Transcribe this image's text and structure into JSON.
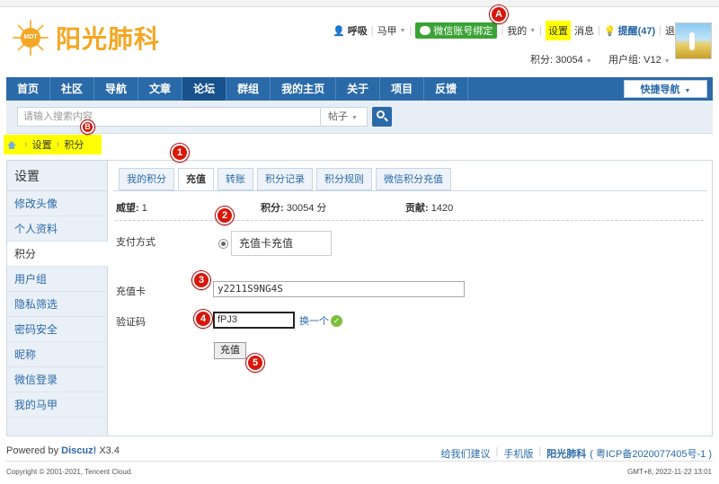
{
  "header": {
    "logo_badge": "MDT",
    "logo_text": "阳光肺科",
    "user": "呼吸",
    "alt_account": "马甲",
    "wechat_bind": "微信账号绑定",
    "mine": "我的",
    "settings": "设置",
    "messages": "消息",
    "reminders": "提醒(47)",
    "logout": "退出",
    "points": "积分: 30054",
    "user_group": "用户组: V12"
  },
  "nav": {
    "items": [
      "首页",
      "社区",
      "导航",
      "文章",
      "论坛",
      "群组",
      "我的主页",
      "关于",
      "项目",
      "反馈"
    ],
    "active": "论坛",
    "quick_nav": "快捷导航"
  },
  "search": {
    "placeholder": "请输入搜索内容",
    "scope": "帖子"
  },
  "breadcrumb": [
    "设置",
    "积分"
  ],
  "markers": [
    "A",
    "B",
    "1",
    "2",
    "3",
    "4",
    "5"
  ],
  "sidebar": {
    "title": "设置",
    "items": [
      "修改头像",
      "个人资料",
      "积分",
      "用户组",
      "隐私筛选",
      "密码安全",
      "昵称",
      "微信登录",
      "我的马甲"
    ],
    "active": "积分"
  },
  "tabs": [
    "我的积分",
    "充值",
    "转账",
    "积分记录",
    "积分规则",
    "微信积分充值"
  ],
  "stats": {
    "prestige_label": "威望:",
    "prestige": "1",
    "points_label": "积分:",
    "points": "30054 分",
    "contrib_label": "贡献:",
    "contrib": "1420"
  },
  "form": {
    "pay_label": "支付方式",
    "pay_option": "充值卡充值",
    "card_label": "充值卡",
    "card_value": "y2211S9NG4S",
    "captcha_label": "验证码",
    "captcha_value": "fPJ3",
    "change_label": "换一个",
    "submit": "充值"
  },
  "footer": {
    "powered": "Powered by ",
    "discuz": "Discuz!",
    "version": " X3.4",
    "links": [
      "给我们建议",
      "手机版",
      "阳光肺科",
      "( 粤ICP备2020077405号-1 )"
    ],
    "copyright": "Copyright © 2001-2021, Tencent Cloud.",
    "time": "GMT+8, 2022-11-22 13:01"
  },
  "colors": {
    "accent": "#2b6aa8",
    "highlight": "#ffff00",
    "marker": "#d9160a",
    "logo": "#f5a623"
  }
}
